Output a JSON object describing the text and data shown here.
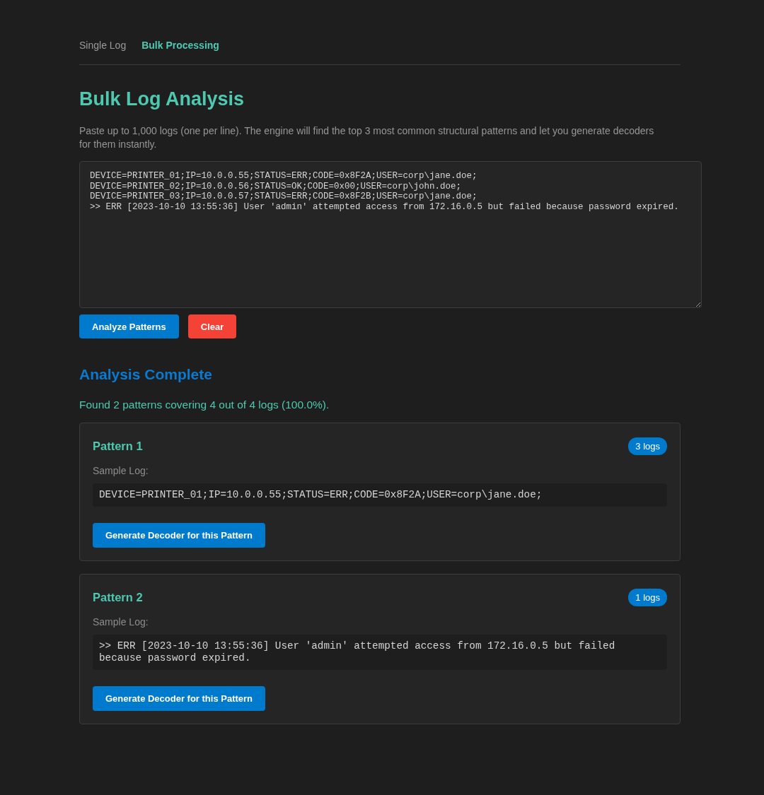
{
  "tabs": [
    {
      "label": "Single Log",
      "selected": false
    },
    {
      "label": "Bulk Processing",
      "selected": true
    }
  ],
  "title": "Bulk Log Analysis",
  "description": "Paste up to 1,000 logs (one per line). The engine will find the top 3 most common structural patterns and let you generate decoders for them instantly.",
  "log_input": {
    "value": "DEVICE=PRINTER_01;IP=10.0.0.55;STATUS=ERR;CODE=0x8F2A;USER=corp\\jane.doe;\nDEVICE=PRINTER_02;IP=10.0.0.56;STATUS=OK;CODE=0x00;USER=corp\\john.doe;\nDEVICE=PRINTER_03;IP=10.0.0.57;STATUS=ERR;CODE=0x8F2B;USER=corp\\jane.doe;\n>> ERR [2023-10-10 13:55:36] User 'admin' attempted access from 172.16.0.5 but failed because password expired."
  },
  "buttons": [
    {
      "label": "Analyze Patterns",
      "kind": "primary"
    },
    {
      "label": "Clear",
      "kind": "danger"
    }
  ],
  "results": {
    "heading": "Analysis Complete",
    "summary": "Found 2 patterns covering 4 out of 4 logs (100.0%).",
    "patterns": [
      {
        "title": "Pattern 1",
        "count": "3 logs",
        "sample_label": "Sample Log:",
        "sample": "DEVICE=PRINTER_01;IP=10.0.0.55;STATUS=ERR;CODE=0x8F2A;USER=corp\\jane.doe;",
        "button": "Generate Decoder for this Pattern"
      },
      {
        "title": "Pattern 2",
        "count": "1 logs",
        "sample_label": "Sample Log:",
        "sample": ">> ERR [2023-10-10 13:55:36] User 'admin' attempted access from 172.16.0.5 but failed because password expired.",
        "button": "Generate Decoder for this Pattern"
      }
    ]
  }
}
